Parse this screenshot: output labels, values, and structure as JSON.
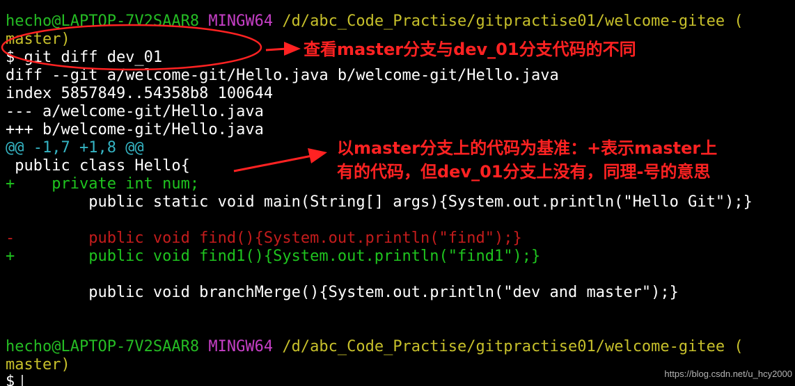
{
  "terminal": {
    "prompt1": {
      "user": "hecho@LAPTOP-7V2SAAR8",
      "host": "MINGW64",
      "path": "/d/abc_Code_Practise/gitpractise01/welcome-gitee (",
      "branch": "master)"
    },
    "command": "$ git diff dev_01",
    "diff_header": [
      "diff --git a/welcome-git/Hello.java b/welcome-git/Hello.java",
      "index 5857849..54358b8 100644",
      "--- a/welcome-git/Hello.java",
      "+++ b/welcome-git/Hello.java"
    ],
    "hunk": "@@ -1,7 +1,8 @@",
    "lines": {
      "class_decl": " public class Hello{",
      "added_field": "+    private int num;",
      "main_method": "         public static void main(String[] args){System.out.println(\"Hello Git\");}",
      "removed_find": "-        public void find(){System.out.println(\"find\");}",
      "added_find1": "+        public void find1(){System.out.println(\"find1\");}",
      "branch_merge": "         public void branchMerge(){System.out.println(\"dev and master\");}"
    },
    "prompt2": {
      "user": "hecho@LAPTOP-7V2SAAR8",
      "host": "MINGW64",
      "path": "/d/abc_Code_Practise/gitpractise01/welcome-gitee (",
      "branch": "master)"
    },
    "final_prompt": "$"
  },
  "annotations": {
    "note1": "查看master分支与dev_01分支代码的不同",
    "note2_line1": "以master分支上的代码为基准：+表示master上",
    "note2_line2": "有的代码，但dev_01分支上没有，同理-号的意思"
  },
  "watermark": "https://blog.csdn.net/u_hcy2000",
  "colors": {
    "background": "#000000",
    "user": "#25bc24",
    "host": "#c63fc6",
    "path": "#c7c02b",
    "hunk": "#35b4c3",
    "added": "#1fc41f",
    "removed": "#c41c1c",
    "annotation": "#ff2222"
  }
}
